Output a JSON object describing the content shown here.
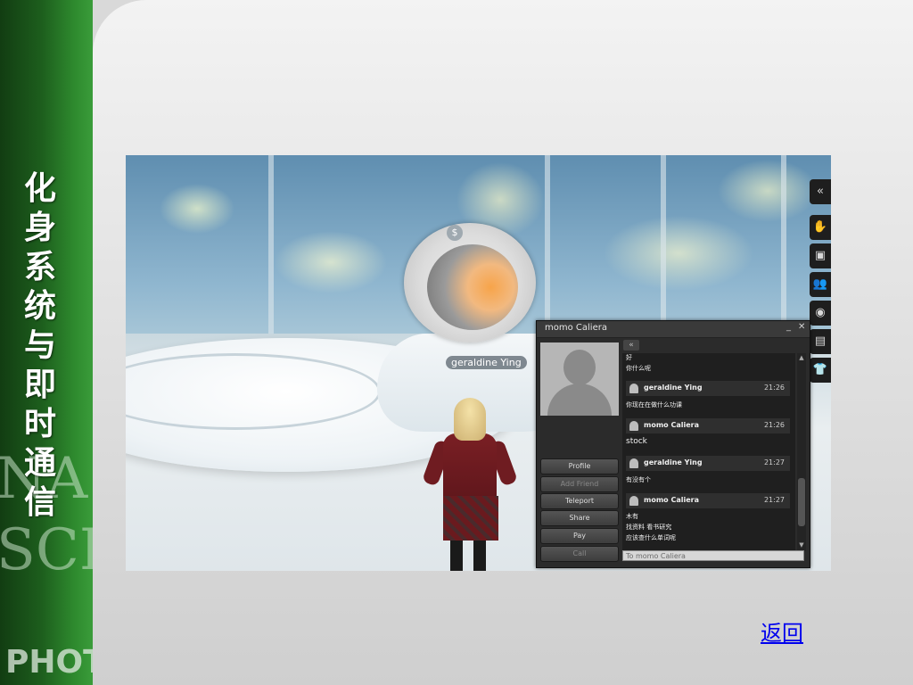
{
  "slide": {
    "title_chars": [
      "化",
      "身",
      "系",
      "统",
      "与",
      "即",
      "时",
      "通",
      "信"
    ],
    "watermark_lines": [
      "NA",
      "SCI",
      "PHOTO"
    ],
    "back_link": "返回"
  },
  "viewer": {
    "avatar_nametag": "geraldine Ying",
    "toolbar_icons": [
      "collapse-icon",
      "gesture-icon",
      "profile-icon",
      "people-icon",
      "camera-icon",
      "inventory-icon",
      "appearance-icon"
    ],
    "toolbar_glyphs": [
      "«",
      "✋",
      "▣",
      "👥",
      "◉",
      "▤",
      "👕"
    ]
  },
  "im": {
    "title": "momo Caliera",
    "min_glyph": "_",
    "close_glyph": "✕",
    "collapse_glyph": "«",
    "buttons": [
      {
        "label": "Profile",
        "enabled": true
      },
      {
        "label": "Add Friend",
        "enabled": false
      },
      {
        "label": "Teleport",
        "enabled": true
      },
      {
        "label": "Share",
        "enabled": true
      },
      {
        "label": "Pay",
        "enabled": true
      },
      {
        "label": "Call",
        "enabled": false
      }
    ],
    "log_top_lines": [
      "好",
      "你什么呢"
    ],
    "messages": [
      {
        "name": "geraldine Ying",
        "time": "21:26",
        "lines": [
          "你现在在做什么功课"
        ]
      },
      {
        "name": "momo Caliera",
        "time": "21:26",
        "lines": [
          "stock"
        ]
      },
      {
        "name": "geraldine Ying",
        "time": "21:27",
        "lines": [
          "有没有个"
        ]
      },
      {
        "name": "momo Caliera",
        "time": "21:27",
        "lines": [
          "木有",
          "找资料 看书研究",
          "应该查什么单词呢"
        ]
      }
    ],
    "input_placeholder": "To momo Caliera",
    "scroll_up": "▲",
    "scroll_down": "▼"
  }
}
